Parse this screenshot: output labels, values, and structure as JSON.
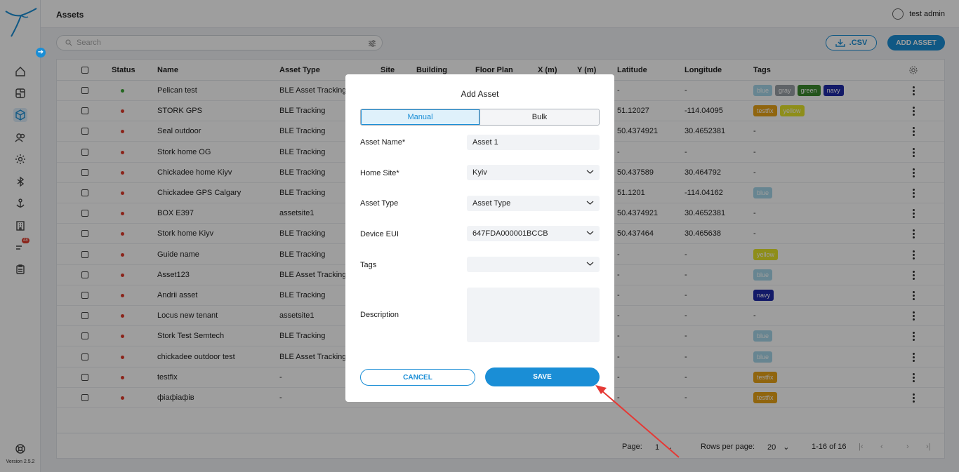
{
  "app": {
    "page_title": "Assets",
    "user_name": "test admin",
    "version": "Version 2.5.2",
    "nav_badge": "48"
  },
  "toolbar": {
    "search_placeholder": "Search",
    "csv_label": ".CSV",
    "add_label": "ADD ASSET"
  },
  "table": {
    "headers": {
      "status": "Status",
      "name": "Name",
      "asset_type": "Asset Type",
      "site": "Site",
      "building": "Building",
      "floor_plan": "Floor Plan",
      "x": "X (m)",
      "y": "Y (m)",
      "latitude": "Latitude",
      "longitude": "Longitude",
      "tags": "Tags"
    },
    "rows": [
      {
        "name": "Pelican test",
        "type": "BLE Asset Tracking",
        "lat": "-",
        "lon": "-",
        "status": "green",
        "tags": [
          {
            "t": "blue",
            "c": "#a7d7ea"
          },
          {
            "t": "gray",
            "c": "#9aa0a6"
          },
          {
            "t": "green",
            "c": "#3a8a2e"
          },
          {
            "t": "navy",
            "c": "#1f2aa8"
          }
        ]
      },
      {
        "name": "STORK GPS",
        "type": "BLE Tracking",
        "lat": "51.12027",
        "lon": "-114.04095",
        "status": "red",
        "tags": [
          {
            "t": "testfix",
            "c": "#e8a418"
          },
          {
            "t": "yellow",
            "c": "#e5e52a"
          }
        ]
      },
      {
        "name": "Seal outdoor",
        "type": "BLE Tracking",
        "lat": "50.4374921",
        "lon": "30.4652381",
        "status": "red",
        "tags_text": "-"
      },
      {
        "name": "Stork home OG",
        "type": "BLE Tracking",
        "lat": "-",
        "lon": "-",
        "status": "red",
        "tags_text": "-"
      },
      {
        "name": "Chickadee home Kiyv",
        "type": "BLE Tracking",
        "lat": "50.437589",
        "lon": "30.464792",
        "status": "red",
        "tags_text": "-"
      },
      {
        "name": "Chickadee GPS Calgary",
        "type": "BLE Tracking",
        "lat": "51.1201",
        "lon": "-114.04162",
        "status": "red",
        "tags": [
          {
            "t": "blue",
            "c": "#a7d7ea"
          }
        ]
      },
      {
        "name": "BOX E397",
        "type": "assetsite1",
        "lat": "50.4374921",
        "lon": "30.4652381",
        "status": "red",
        "tags_text": "-"
      },
      {
        "name": "Stork home Kiyv",
        "type": "BLE Tracking",
        "lat": "50.437464",
        "lon": "30.465638",
        "status": "red",
        "tags_text": "-"
      },
      {
        "name": "Guide name",
        "type": "BLE Tracking",
        "lat": "-",
        "lon": "-",
        "status": "red",
        "tags": [
          {
            "t": "yellow",
            "c": "#e5e52a"
          }
        ]
      },
      {
        "name": "Asset123",
        "type": "BLE Asset Tracking",
        "lat": "-",
        "lon": "-",
        "status": "red",
        "tags": [
          {
            "t": "blue",
            "c": "#a7d7ea"
          }
        ]
      },
      {
        "name": "Andrii asset",
        "type": "BLE Tracking",
        "lat": "-",
        "lon": "-",
        "status": "red",
        "tags": [
          {
            "t": "navy",
            "c": "#1f2aa8"
          }
        ]
      },
      {
        "name": "Locus new tenant",
        "type": "assetsite1",
        "lat": "-",
        "lon": "-",
        "status": "red",
        "tags_text": "-"
      },
      {
        "name": "Stork Test Semtech",
        "type": "BLE Tracking",
        "lat": "-",
        "lon": "-",
        "status": "red",
        "tags": [
          {
            "t": "blue",
            "c": "#a7d7ea"
          }
        ]
      },
      {
        "name": "chickadee outdoor test",
        "type": "BLE Asset Tracking",
        "lat": "-",
        "lon": "-",
        "status": "red",
        "tags": [
          {
            "t": "blue",
            "c": "#a7d7ea"
          }
        ]
      },
      {
        "name": "testfix",
        "type": "-",
        "lat": "-",
        "lon": "-",
        "status": "red",
        "tags": [
          {
            "t": "testfix",
            "c": "#e8a418"
          }
        ]
      },
      {
        "name": "фіафіафів",
        "type": "-",
        "lat": "-",
        "lon": "-",
        "status": "red",
        "tags": [
          {
            "t": "testfix",
            "c": "#e8a418"
          }
        ]
      }
    ],
    "footer": {
      "page_label": "Page:",
      "page_value": "1",
      "rows_label": "Rows per page:",
      "rows_value": "20",
      "range": "1-16 of 16"
    }
  },
  "modal": {
    "title": "Add Asset",
    "tab_manual": "Manual",
    "tab_bulk": "Bulk",
    "fields": {
      "asset_name_label": "Asset Name*",
      "asset_name_value": "Asset 1",
      "home_site_label": "Home Site*",
      "home_site_value": "Kyiv",
      "asset_type_label": "Asset Type",
      "asset_type_value": "Asset Type",
      "device_eui_label": "Device EUI",
      "device_eui_value": "647FDA000001BCCB",
      "tags_label": "Tags",
      "description_label": "Description"
    },
    "cancel_label": "CANCEL",
    "save_label": "SAVE"
  },
  "colors": {
    "accent": "#1a8ed6",
    "status_green": "#3aa635",
    "status_red": "#e03a2b",
    "annotation_arrow": "#e53935"
  }
}
